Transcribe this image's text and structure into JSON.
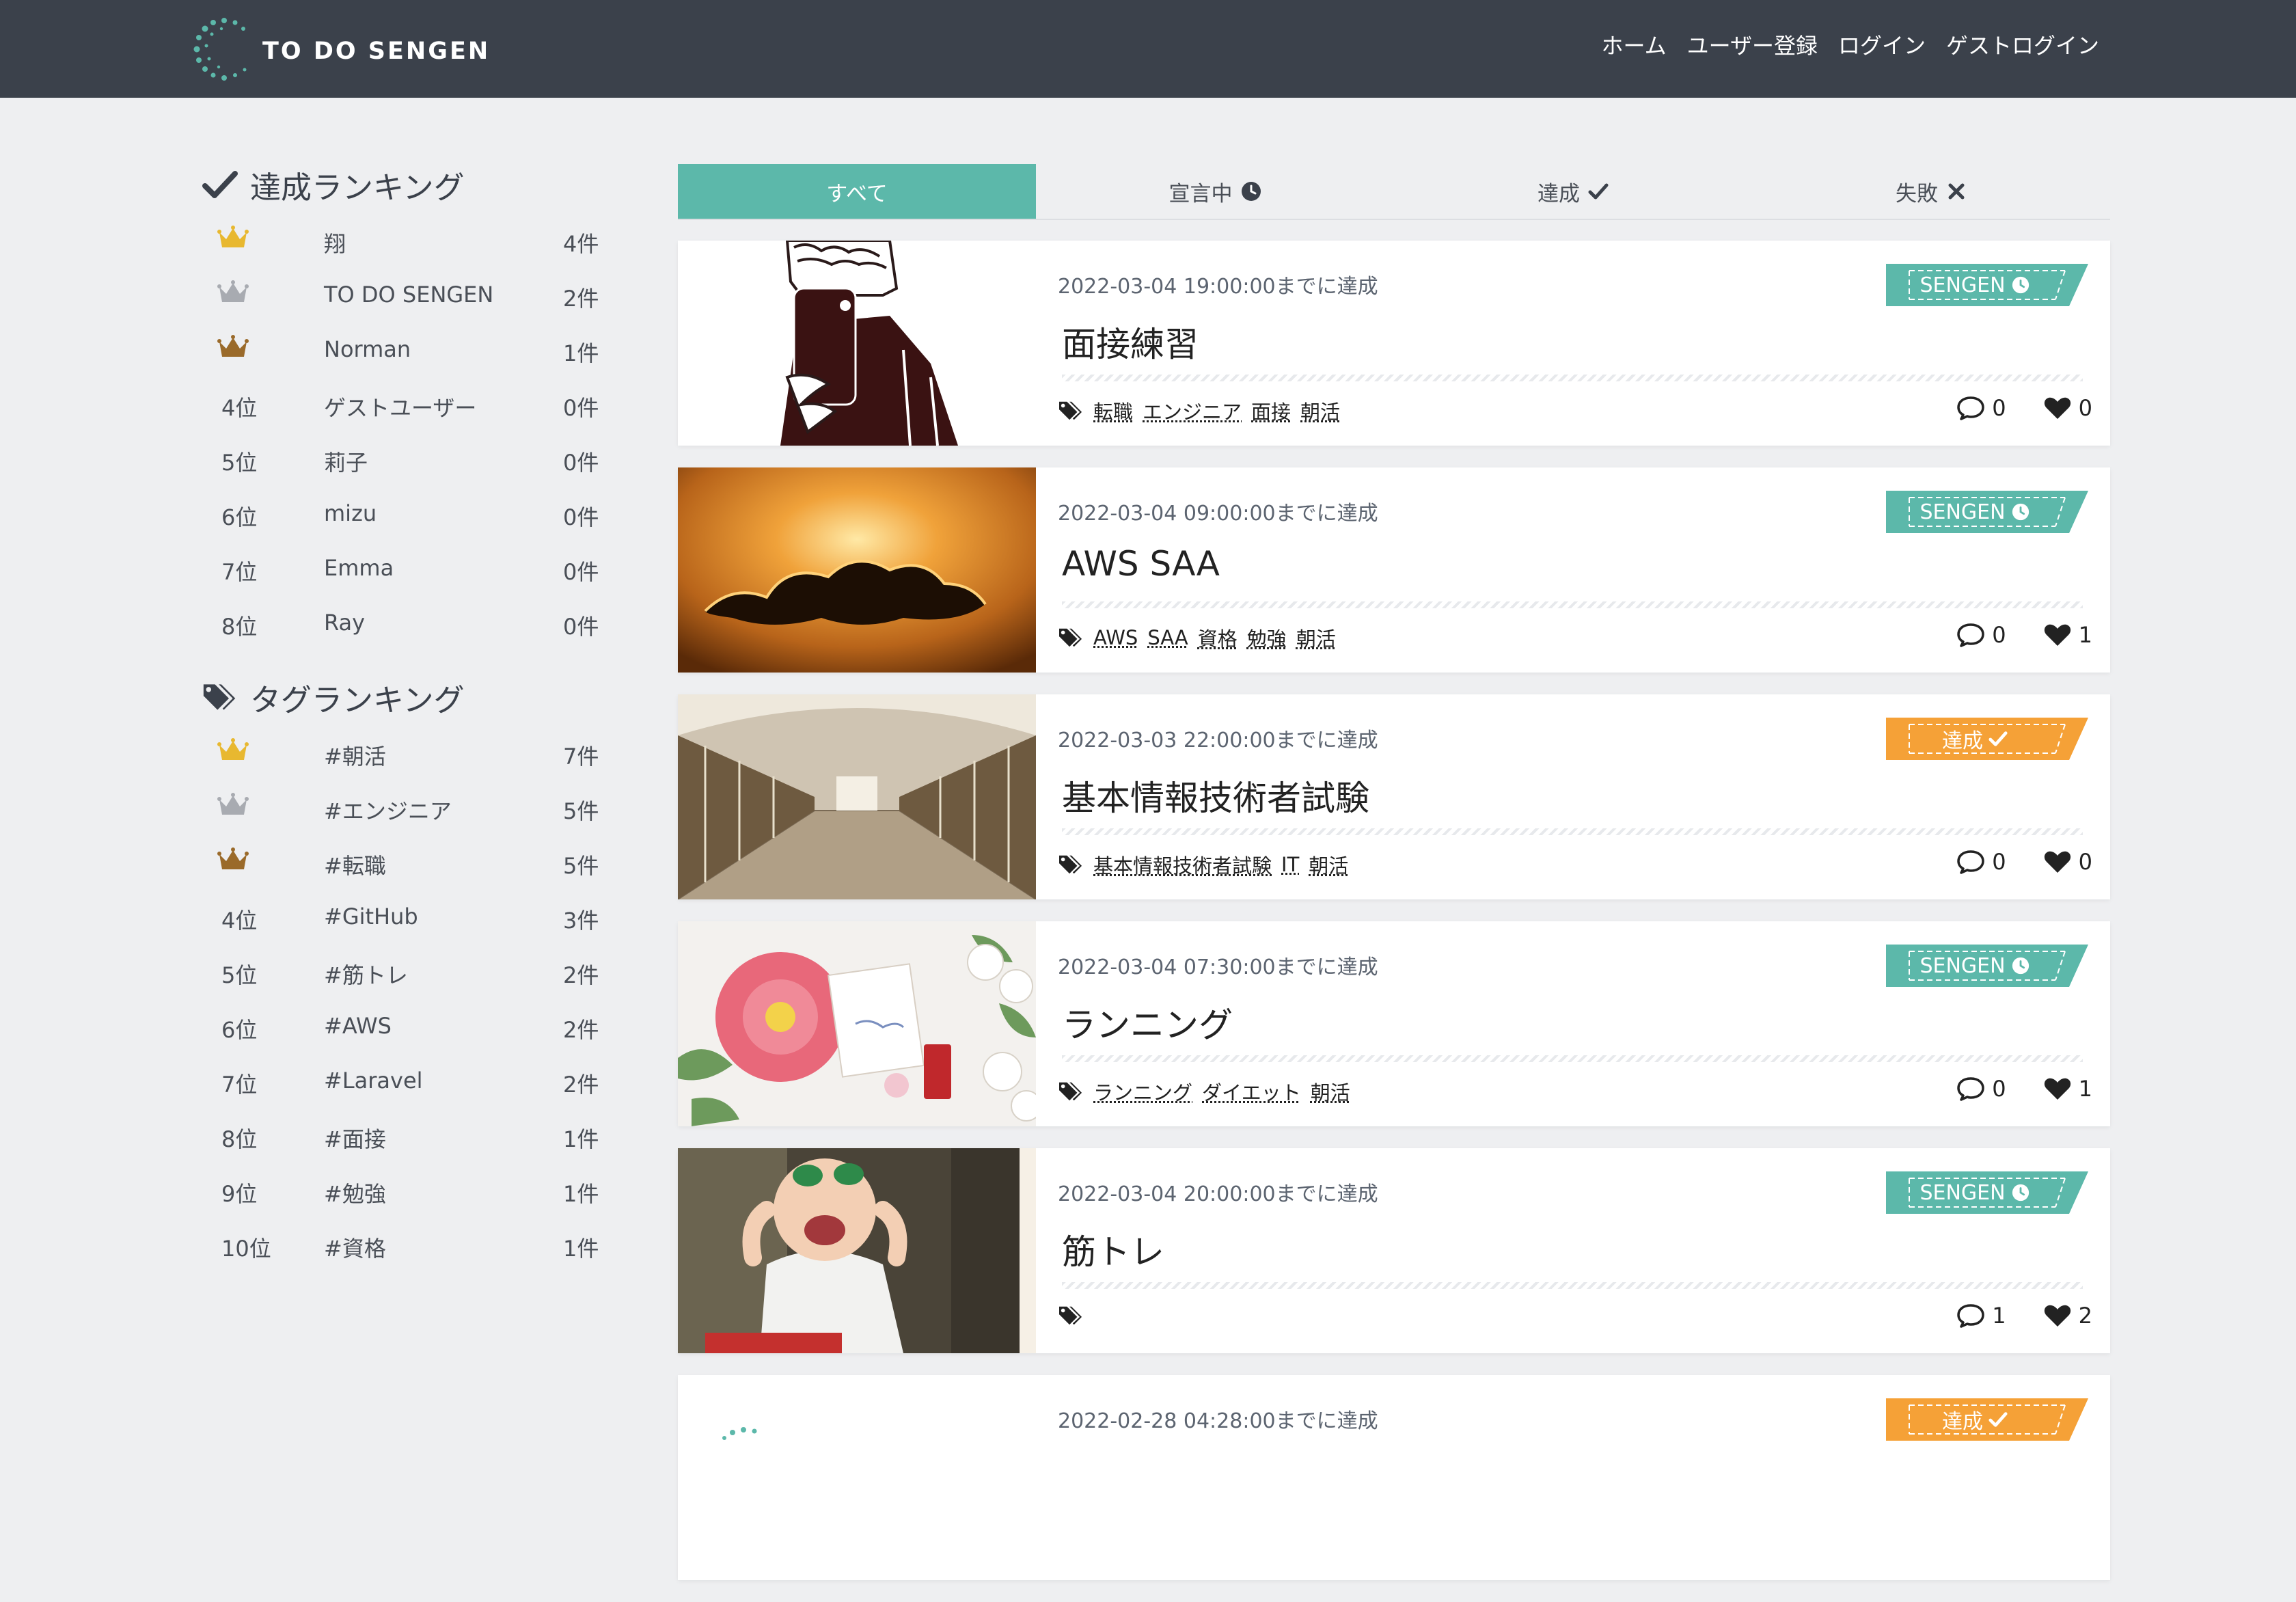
{
  "header": {
    "logo_text": "TO DO SENGEN",
    "nav": [
      "ホーム",
      "ユーザー登録",
      "ログイン",
      "ゲストログイン"
    ]
  },
  "achievement_ranking": {
    "title": "達成ランキング",
    "items": [
      {
        "pos": "",
        "crown": "gold",
        "name": "翔",
        "count": "4件"
      },
      {
        "pos": "",
        "crown": "silver",
        "name": "TO DO SENGEN",
        "count": "2件"
      },
      {
        "pos": "",
        "crown": "bronze",
        "name": "Norman",
        "count": "1件"
      },
      {
        "pos": "4位",
        "name": "ゲストユーザー",
        "count": "0件"
      },
      {
        "pos": "5位",
        "name": "莉子",
        "count": "0件"
      },
      {
        "pos": "6位",
        "name": "mizu",
        "count": "0件"
      },
      {
        "pos": "7位",
        "name": "Emma",
        "count": "0件"
      },
      {
        "pos": "8位",
        "name": "Ray",
        "count": "0件"
      }
    ]
  },
  "tag_ranking": {
    "title": "タグランキング",
    "items": [
      {
        "pos": "",
        "crown": "gold",
        "name": "#朝活",
        "count": "7件"
      },
      {
        "pos": "",
        "crown": "silver",
        "name": "#エンジニア",
        "count": "5件"
      },
      {
        "pos": "",
        "crown": "bronze",
        "name": "#転職",
        "count": "5件"
      },
      {
        "pos": "4位",
        "name": "#GitHub",
        "count": "3件"
      },
      {
        "pos": "5位",
        "name": "#筋トレ",
        "count": "2件"
      },
      {
        "pos": "6位",
        "name": "#AWS",
        "count": "2件"
      },
      {
        "pos": "7位",
        "name": "#Laravel",
        "count": "2件"
      },
      {
        "pos": "8位",
        "name": "#面接",
        "count": "1件"
      },
      {
        "pos": "9位",
        "name": "#勉強",
        "count": "1件"
      },
      {
        "pos": "10位",
        "name": "#資格",
        "count": "1件"
      }
    ]
  },
  "tabs": [
    {
      "label": "すべて",
      "icon": "",
      "active": true
    },
    {
      "label": "宣言中",
      "icon": "clock-icon"
    },
    {
      "label": "達成",
      "icon": "check-icon"
    },
    {
      "label": "失敗",
      "icon": "x-icon"
    }
  ],
  "colors": {
    "header_bg": "#3b414b",
    "accent_teal": "#5cb8aa",
    "accent_orange": "#f5a137",
    "background": "#eeeff1"
  },
  "cards": [
    {
      "image": "phone-illustration",
      "date": "2022-03-04 19:00:00までに達成",
      "title": "面接練習",
      "badge": "SENGEN",
      "badge_type": "sengen",
      "tags": [
        "転職",
        "エンジニア",
        "面接",
        "朝活"
      ],
      "comments": "0",
      "likes": "0"
    },
    {
      "image": "sunset-cloud",
      "date": "2022-03-04 09:00:00までに達成",
      "title": "AWS SAA",
      "badge": "SENGEN",
      "badge_type": "sengen",
      "tags": [
        "AWS",
        "SAA",
        "資格",
        "勉強",
        "朝活"
      ],
      "comments": "0",
      "likes": "1"
    },
    {
      "image": "library-hall",
      "date": "2022-03-03 22:00:00までに達成",
      "title": "基本情報技術者試験",
      "badge": "達成",
      "badge_type": "done",
      "tags": [
        "基本情報技術者試験",
        "IT",
        "朝活"
      ],
      "comments": "0",
      "likes": "0"
    },
    {
      "image": "flowers-desk",
      "date": "2022-03-04 07:30:00までに達成",
      "title": "ランニング",
      "badge": "SENGEN",
      "badge_type": "sengen",
      "tags": [
        "ランニング",
        "ダイエット",
        "朝活"
      ],
      "comments": "0",
      "likes": "1"
    },
    {
      "image": "baby-glasses",
      "date": "2022-03-04 20:00:00までに達成",
      "title": "筋トレ",
      "badge": "SENGEN",
      "badge_type": "sengen",
      "tags": [],
      "comments": "1",
      "likes": "2"
    },
    {
      "image": "logo-partial",
      "date": "2022-02-28 04:28:00までに達成",
      "title": "",
      "badge": "達成",
      "badge_type": "done",
      "tags": [],
      "comments": "",
      "likes": ""
    }
  ]
}
